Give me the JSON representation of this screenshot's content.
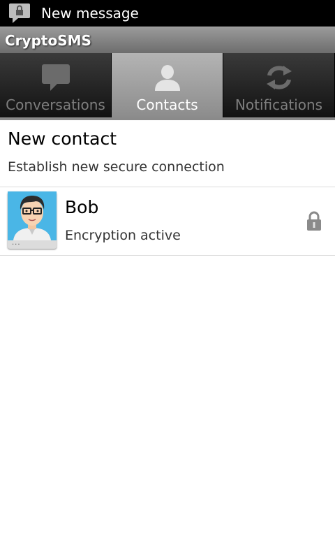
{
  "status_bar": {
    "notification_text": "New message",
    "icon": "locked-message-icon"
  },
  "app": {
    "title": "CryptoSMS"
  },
  "tabs": [
    {
      "label": "Conversations",
      "icon": "speech-bubble-icon",
      "selected": false
    },
    {
      "label": "Contacts",
      "icon": "person-icon",
      "selected": true
    },
    {
      "label": "Notifications",
      "icon": "sync-icon",
      "selected": false
    }
  ],
  "new_contact": {
    "title": "New contact",
    "subtitle": "Establish new secure connection"
  },
  "contacts": [
    {
      "name": "Bob",
      "status": "Encryption active",
      "avatar_badge": "...",
      "icon": "lock-icon"
    }
  ],
  "colors": {
    "selected_tab": "#a0a0a0",
    "title_bar": "#828282",
    "status_bar": "#000000"
  }
}
